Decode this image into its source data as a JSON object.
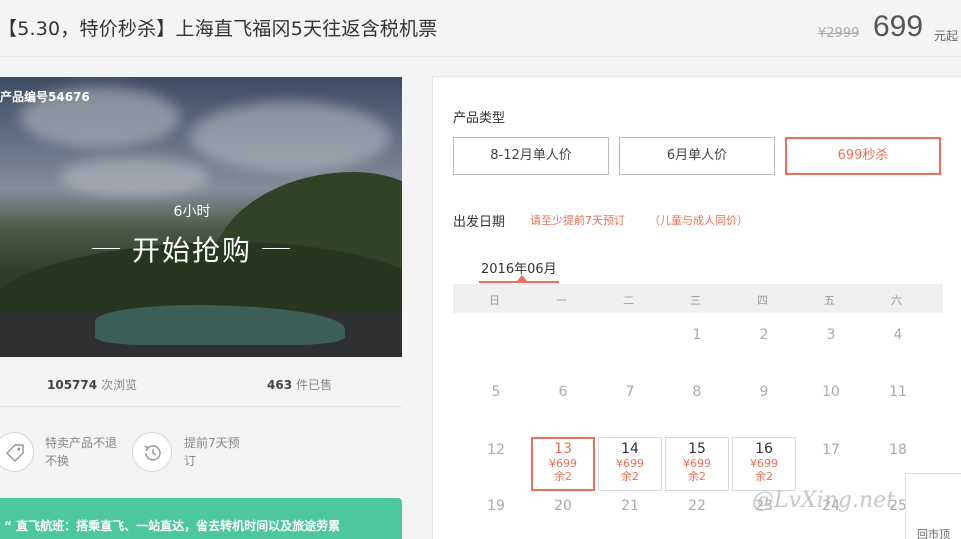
{
  "header": {
    "title": "【5.30，特价秒杀】上海直飞福冈5天往返含税机票",
    "old_price": "¥2999",
    "price": "699",
    "price_unit": "元起"
  },
  "hero": {
    "product_code": "产品编号54676",
    "countdown": "6小时",
    "buy_start": "开始抢购"
  },
  "stats": {
    "views_count": "105774",
    "views_label": "次浏览",
    "sold_count": "463",
    "sold_label": "件已售"
  },
  "features": [
    {
      "icon": "tag-icon",
      "text": "特卖产品不退不换"
    },
    {
      "icon": "clock-history-icon",
      "text": "提前7天预订"
    }
  ],
  "banner": {
    "text": "“ 直飞航班：搭乘直飞、一站直达，省去转机时间以及旅途劳累"
  },
  "booking": {
    "type_label": "产品类型",
    "types": [
      "8-12月单人价",
      "6月单人价",
      "699秒杀"
    ],
    "selected_type": "699秒杀",
    "date_label": "出发日期",
    "hint1": "请至少提前7天预订",
    "hint2": "（儿童与成人同价）",
    "month": "2016年06月",
    "weekdays": [
      "日",
      "一",
      "二",
      "三",
      "四",
      "五",
      "六"
    ],
    "days_row1": [
      "1",
      "2",
      "3",
      "4"
    ],
    "days_row2": [
      "5",
      "6",
      "7",
      "8",
      "9",
      "10",
      "11"
    ],
    "days_row3_left": "12",
    "bookable": [
      {
        "day": "13",
        "price": "¥699",
        "stock": "余2"
      },
      {
        "day": "14",
        "price": "¥699",
        "stock": "余2"
      },
      {
        "day": "15",
        "price": "¥699",
        "stock": "余2"
      },
      {
        "day": "16",
        "price": "¥699",
        "stock": "余2"
      }
    ],
    "days_row3_right": [
      "17",
      "18"
    ],
    "days_row4": [
      "19",
      "20",
      "21",
      "22",
      "23",
      "24",
      "25"
    ]
  },
  "watermark": "@LvXing.net",
  "back_top": "回市顶",
  "colors": {
    "accent": "#ec6f59",
    "banner": "#4dc7a0"
  }
}
